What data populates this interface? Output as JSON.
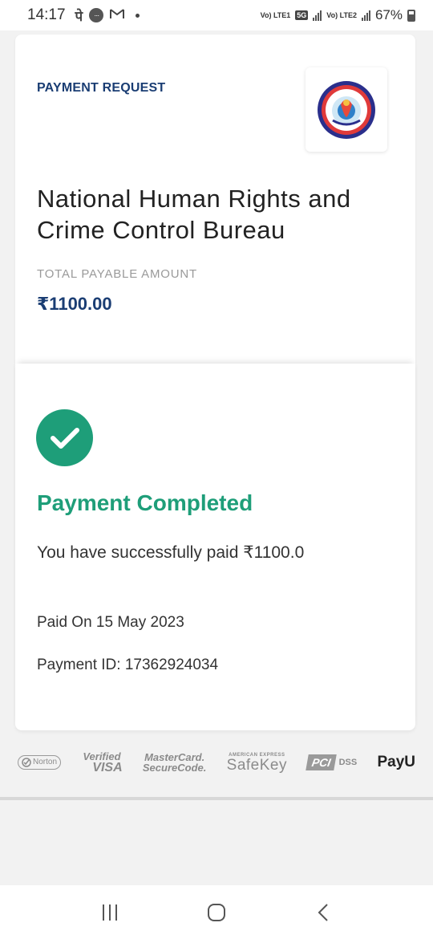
{
  "status_bar": {
    "time": "14:17",
    "glyph_pe": "पे",
    "chat_glyph": "···",
    "battery": "67%",
    "sim1": "Vo) LTE1",
    "sim2": "Vo) LTE2",
    "network": "5G",
    "icons": [
      "phonepe-icon",
      "chat-icon",
      "gmail-icon",
      "notification-dot-icon",
      "5g-icon",
      "signal-icon",
      "battery-icon"
    ]
  },
  "header": {
    "label": "PAYMENT REQUEST",
    "logo_text": "NATIONAL HUMAN RIGHTS AND CRIME CONTROL BUREAU · NHRCCB"
  },
  "merchant": {
    "name": "National Human Rights and Crime Control Bureau"
  },
  "amount": {
    "label": "TOTAL PAYABLE AMOUNT",
    "value": "₹1100.00"
  },
  "result": {
    "title": "Payment Completed",
    "message": "You have successfully paid ₹1100.0",
    "paid_on": "Paid On 15 May 2023",
    "payment_id": "Payment ID: 17362924034",
    "accent_color": "#1e9e79"
  },
  "trust_badges": {
    "norton": "Norton",
    "norton_sub": "SECURED",
    "visa_top": "Verified",
    "visa_bottom": "VISA",
    "mc_top": "MasterCard.",
    "mc_bottom": "SecureCode.",
    "amex_top": "AMERICAN EXPRESS",
    "amex_bottom": "SafeKey",
    "pci": "PCI",
    "dss": "DSS",
    "payu": "PayU"
  },
  "nav": {
    "icons": [
      "recent-apps-icon",
      "home-icon",
      "back-icon"
    ]
  },
  "colors": {
    "brand_blue": "#1a3d73",
    "success_green": "#1e9e79",
    "muted_gray": "#9a9a9a"
  }
}
